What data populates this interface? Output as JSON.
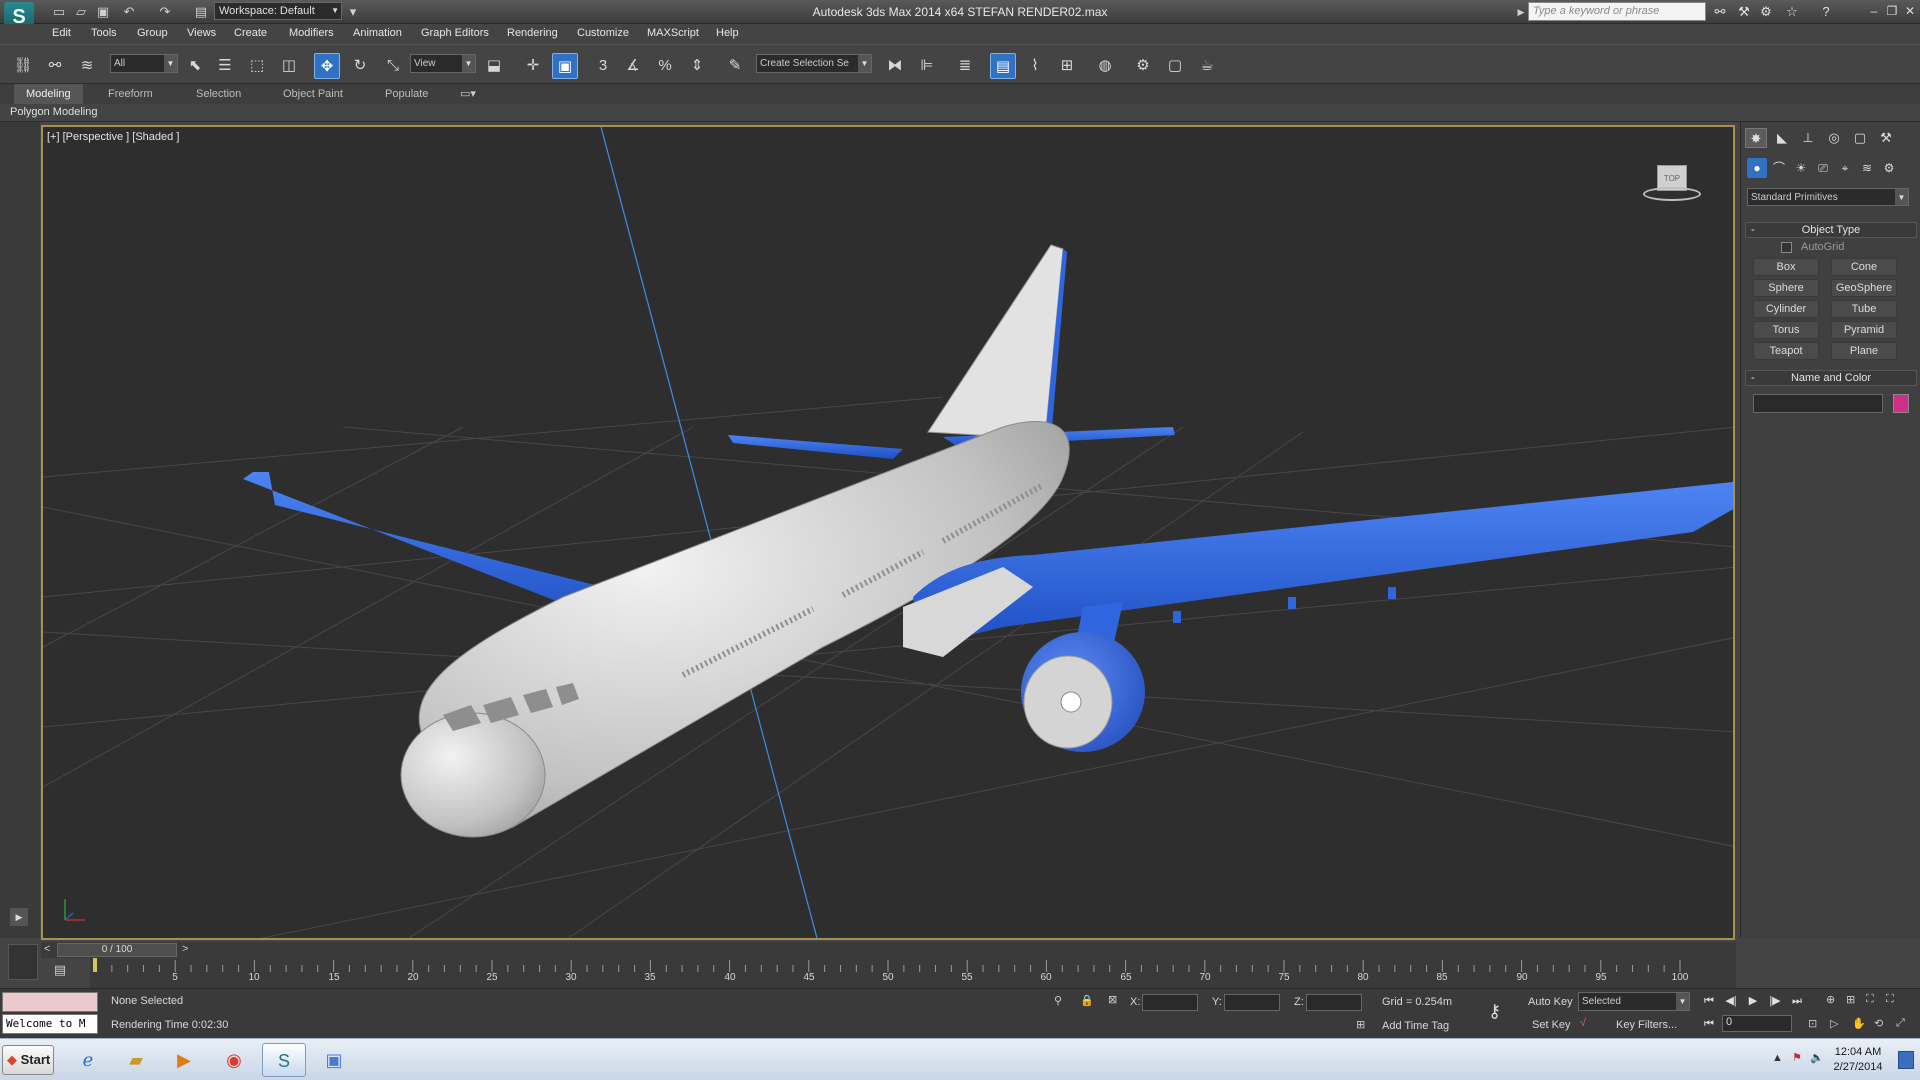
{
  "title_bar": {
    "window_title": "Autodesk 3ds Max  2014 x64     STEFAN RENDER02.max",
    "workspace": "Workspace: Default",
    "search_placeholder": "Type a keyword or phrase",
    "app_logo_letter": "S"
  },
  "menu": [
    "Edit",
    "Tools",
    "Group",
    "Views",
    "Create",
    "Modifiers",
    "Animation",
    "Graph Editors",
    "Rendering",
    "Customize",
    "MAXScript",
    "Help"
  ],
  "toolbar": {
    "selection_filter": "All",
    "ref_coord": "View",
    "snap_3": "3",
    "named_selection": "Create Selection Se"
  },
  "ribbon": {
    "tabs": [
      "Modeling",
      "Freeform",
      "Selection",
      "Object Paint",
      "Populate"
    ],
    "panel_label": "Polygon Modeling"
  },
  "viewport": {
    "label": "[+] [Perspective ] [Shaded ]",
    "viewcube_label": "TOP",
    "colors": {
      "fuselage": "#c8c8c8",
      "wings": "#2f66e0",
      "ground_grid": "#4a4a4a",
      "axis_line": "#3a8fe6"
    }
  },
  "command_panel": {
    "primitive_dropdown": "Standard Primitives",
    "object_type_title": "Object Type",
    "autogrid_label": "AutoGrid",
    "buttons": [
      "Box",
      "Cone",
      "Sphere",
      "GeoSphere",
      "Cylinder",
      "Tube",
      "Torus",
      "Pyramid",
      "Teapot",
      "Plane"
    ],
    "name_color_title": "Name and Color",
    "object_color": "#d02e8b"
  },
  "timeline": {
    "frame_counter": "0 / 100",
    "ticks": [
      "5",
      "10",
      "15",
      "20",
      "25",
      "30",
      "35",
      "40",
      "45",
      "50",
      "55",
      "60",
      "65",
      "70",
      "75",
      "80",
      "85",
      "90",
      "95",
      "100"
    ]
  },
  "status": {
    "selection_status": "None Selected",
    "rendering_time": "Rendering Time  0:02:30",
    "x_label": "X:",
    "y_label": "Y:",
    "z_label": "Z:",
    "grid": "Grid = 0.254m",
    "add_time_tag": "Add Time Tag",
    "auto_key": "Auto Key",
    "set_key": "Set Key",
    "selected_dropdown": "Selected",
    "key_filters": "Key Filters...",
    "current_frame": "0",
    "welcome": "Welcome to M"
  },
  "taskbar": {
    "start_label": "Start",
    "time": "12:04 AM",
    "date": "2/27/2014"
  }
}
